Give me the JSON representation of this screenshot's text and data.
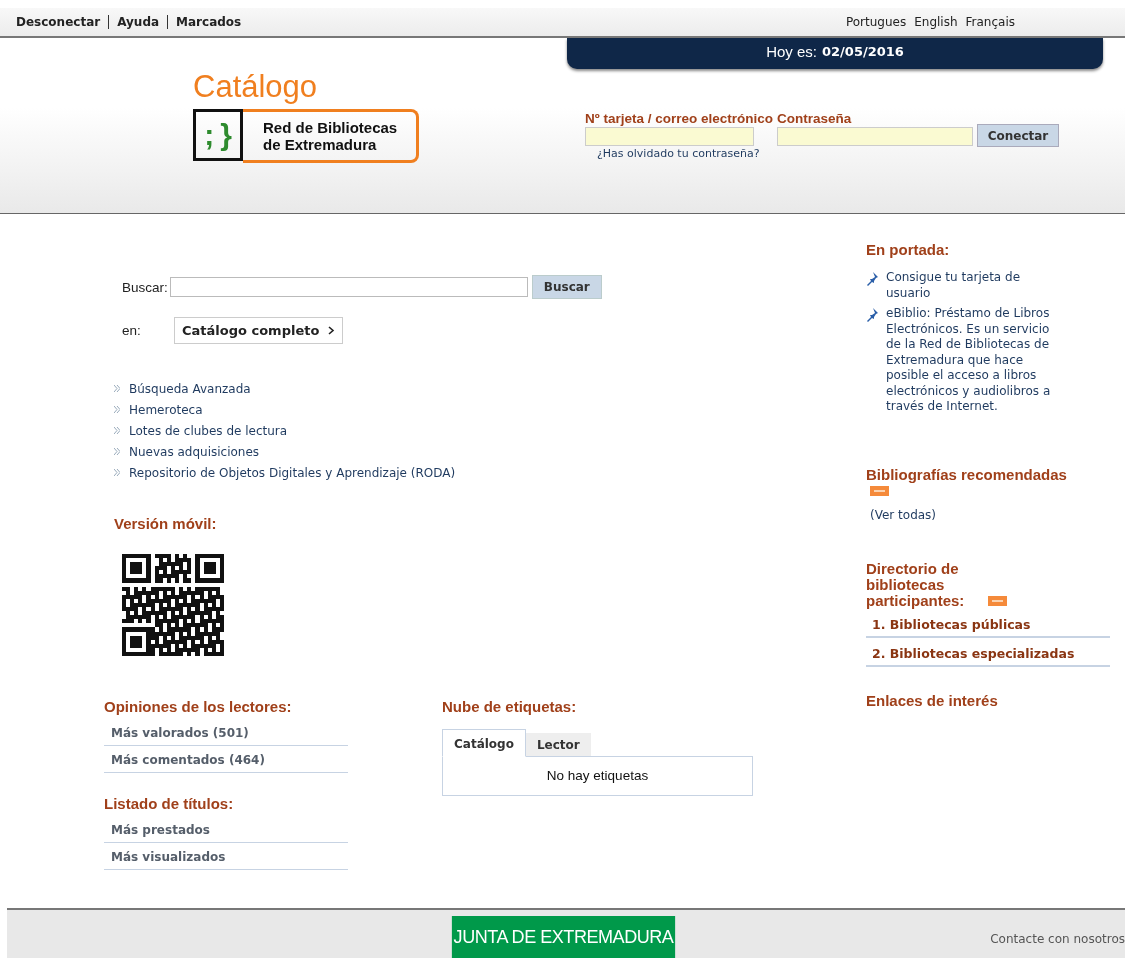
{
  "top_bar": {
    "links": [
      "Desconectar",
      "Ayuda",
      "Marcados"
    ],
    "languages": [
      "Portugues",
      "English",
      "Français"
    ]
  },
  "header": {
    "date_label": "Hoy es:",
    "date": "02/05/2016",
    "title": "Catálogo",
    "logo": {
      "mark_left": ";",
      "mark_right": "}",
      "lines": [
        "Red de Bibliotecas",
        "de Extremadura"
      ]
    },
    "login": {
      "card_label": "Nº tarjeta / correo electrónico",
      "password_label": "Contraseña",
      "forgot": "¿Has olvidado tu contraseña?",
      "button": "Conectar"
    }
  },
  "search": {
    "label": "Buscar:",
    "button": "Buscar",
    "scope_label": "en:",
    "scope": "Catálogo completo"
  },
  "links": [
    "Búsqueda Avanzada",
    "Hemeroteca",
    "Lotes de clubes de lectura",
    "Nuevas adquisiciones",
    "Repositorio de Objetos Digitales y Aprendizaje (RODA)"
  ],
  "mobile": {
    "title": "Versión móvil:"
  },
  "opinions": {
    "title": "Opiniones de los lectores:",
    "items": [
      "Más valorados (501)",
      "Más comentados (464)"
    ]
  },
  "titles": {
    "title": "Listado de títulos:",
    "items": [
      "Más prestados",
      "Más visualizados"
    ]
  },
  "tag_cloud": {
    "title": "Nube de etiquetas:",
    "tabs": [
      {
        "label": "Catálogo",
        "selected": true
      },
      {
        "label": "Lector",
        "selected": false
      }
    ],
    "empty": "No hay etiquetas"
  },
  "sidebar": {
    "front_title": "En portada:",
    "front_items": [
      "Consigue tu tarjeta de usuario",
      "eBiblio: Préstamo de Libros Electrónicos. Es un servicio de la Red de Bibliotecas de Extremadura que hace posible el acceso a libros electrónicos y audiolibros a través de Internet."
    ],
    "biblio_title": "Bibliografías recomendadas",
    "biblio_link": "(Ver todas)",
    "directory_title": "Directorio de bibliotecas participantes:",
    "directory_items": [
      "1. Bibliotecas públicas",
      "2. Bibliotecas especializadas"
    ],
    "links_title": "Enlaces de interés"
  },
  "footer": {
    "logo": "JUNTA DE EXTREMADURA",
    "contact": "Contacte con nosotros"
  }
}
